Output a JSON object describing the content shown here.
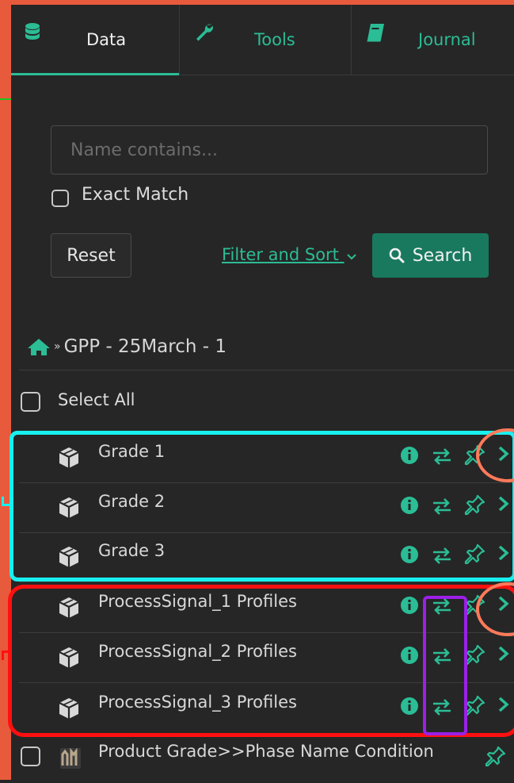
{
  "tabs": [
    {
      "label": "Data",
      "icon": "database-icon",
      "active": true
    },
    {
      "label": "Tools",
      "icon": "wrench-icon",
      "active": false
    },
    {
      "label": "Journal",
      "icon": "book-icon",
      "active": false
    }
  ],
  "search": {
    "placeholder": "Name contains...",
    "value": ""
  },
  "exact_match_label": "Exact Match",
  "buttons": {
    "reset": "Reset",
    "filter_sort": "Filter and Sort",
    "search": "Search"
  },
  "breadcrumb": {
    "home_icon": "home-icon",
    "separator": "»",
    "path": "GPP - 25March - 1"
  },
  "select_all_label": "Select All",
  "items": [
    {
      "name": "Grade 1",
      "icon": "cube-icon"
    },
    {
      "name": "Grade 2",
      "icon": "cube-icon"
    },
    {
      "name": "Grade 3",
      "icon": "cube-icon"
    },
    {
      "name": "ProcessSignal_1 Profiles",
      "icon": "cube-icon"
    },
    {
      "name": "ProcessSignal_2 Profiles",
      "icon": "cube-icon"
    },
    {
      "name": "ProcessSignal_3 Profiles",
      "icon": "cube-icon"
    },
    {
      "name": "Product Grade>>Phase Name Condition",
      "icon": "condition-icon"
    }
  ],
  "colors": {
    "accent": "#2bbd95",
    "search_button": "#19795e",
    "background": "#262626",
    "frame": "#e85a3c",
    "annotation_cyan": "#18f0f0",
    "annotation_red": "#ff1010",
    "annotation_purple": "#9b20e8",
    "annotation_orange": "#ff7a5a"
  }
}
